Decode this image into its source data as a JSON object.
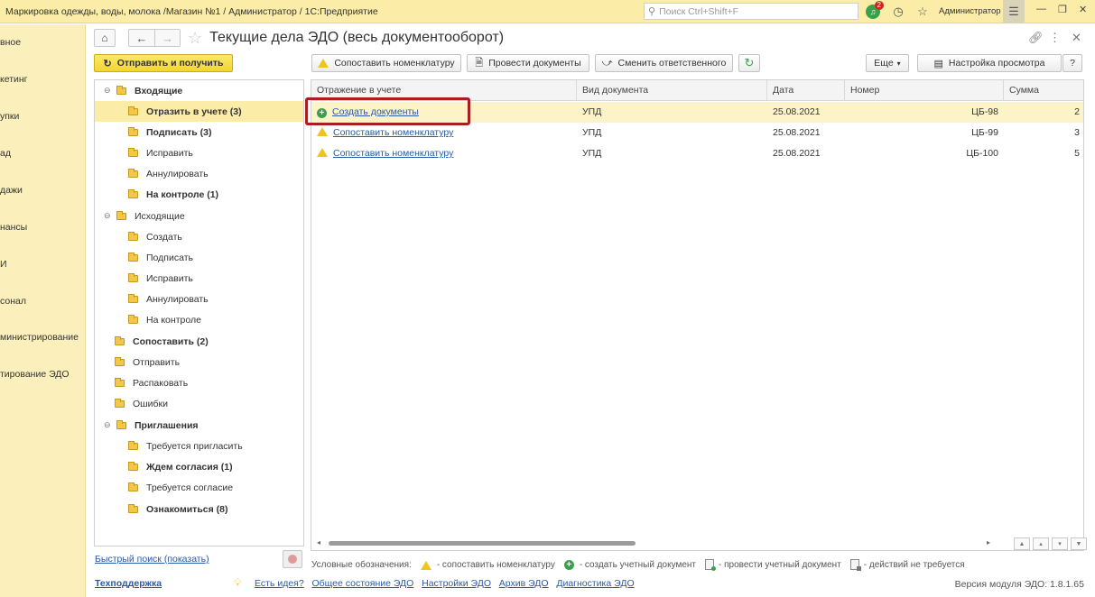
{
  "window": {
    "title": "Маркировка одежды, воды, молока /Магазин №1 / Администратор / 1С:Предприятие",
    "search_placeholder": "Поиск Ctrl+Shift+F",
    "notifications_count": "2",
    "user": "Администратор"
  },
  "sections": [
    {
      "label": "вное"
    },
    {
      "label": "кетинг"
    },
    {
      "label": "упки"
    },
    {
      "label": "ад"
    },
    {
      "label": "дажи"
    },
    {
      "label": "нансы"
    },
    {
      "label": "И"
    },
    {
      "label": "сонал"
    },
    {
      "label": "министрирование"
    },
    {
      "label": "тирование ЭДО"
    }
  ],
  "form": {
    "title": "Текущие дела ЭДО (весь документооборот)"
  },
  "toolbar": {
    "send_receive": "Отправить и получить",
    "match_nomenclature": "Сопоставить номенклатуру",
    "post_documents": "Провести документы",
    "change_responsible": "Сменить ответственного",
    "more": "Еще",
    "view_settings": "Настройка просмотра",
    "help": "?"
  },
  "tree": [
    {
      "label": "Входящие",
      "bold": true
    },
    {
      "label": "Отразить в учете (3)",
      "bold": true
    },
    {
      "label": "Подписать (3)",
      "bold": true
    },
    {
      "label": "Исправить",
      "bold": false
    },
    {
      "label": "Аннулировать",
      "bold": false
    },
    {
      "label": "На контроле (1)",
      "bold": true
    },
    {
      "label": "Исходящие",
      "bold": false
    },
    {
      "label": "Создать",
      "bold": false
    },
    {
      "label": "Подписать",
      "bold": false
    },
    {
      "label": "Исправить",
      "bold": false
    },
    {
      "label": "Аннулировать",
      "bold": false
    },
    {
      "label": "На контроле",
      "bold": false
    },
    {
      "label": "Сопоставить (2)",
      "bold": true
    },
    {
      "label": "Отправить",
      "bold": false
    },
    {
      "label": "Распаковать",
      "bold": false
    },
    {
      "label": "Ошибки",
      "bold": false
    },
    {
      "label": "Приглашения",
      "bold": true
    },
    {
      "label": "Требуется пригласить",
      "bold": false
    },
    {
      "label": "Ждем согласия (1)",
      "bold": true
    },
    {
      "label": "Требуется согласие",
      "bold": false
    },
    {
      "label": "Ознакомиться (8)",
      "bold": true
    }
  ],
  "grid": {
    "columns": [
      "Отражение в учете",
      "Вид документа",
      "Дата",
      "Номер",
      "Сумма"
    ],
    "rows": [
      {
        "action": "Создать документы",
        "icon": "plus-circle-icon",
        "doc_type": "УПД",
        "date": "25.08.2021",
        "number": "ЦБ-98",
        "sum": "2"
      },
      {
        "action": "Сопоставить номенклатуру",
        "icon": "warning-icon",
        "doc_type": "УПД",
        "date": "25.08.2021",
        "number": "ЦБ-99",
        "sum": "3"
      },
      {
        "action": "Сопоставить номенклатуру",
        "icon": "warning-icon",
        "doc_type": "УПД",
        "date": "25.08.2021",
        "number": "ЦБ-100",
        "sum": "5"
      }
    ]
  },
  "quick_search": "Быстрый поиск (показать)",
  "legend": {
    "title": "Условные обозначения:",
    "match": "- сопоставить номенклатуру",
    "create": "- создать учетный документ",
    "post": "- провести учетный документ",
    "none": "- действий не требуется"
  },
  "footer": {
    "support": "Техподдержка",
    "ideas": "Есть идея?",
    "status": "Общее состояние ЭДО",
    "settings": "Настройки ЭДО",
    "archive": "Архив ЭДО",
    "diagnostics": "Диагностика ЭДО",
    "version": "Версия модуля ЭДО: 1.8.1.65"
  },
  "colors": {
    "accent": "#fbeda7",
    "primary_button": "#f2d52f",
    "link": "#2a5aa8",
    "highlight_border": "#a91e1e"
  }
}
